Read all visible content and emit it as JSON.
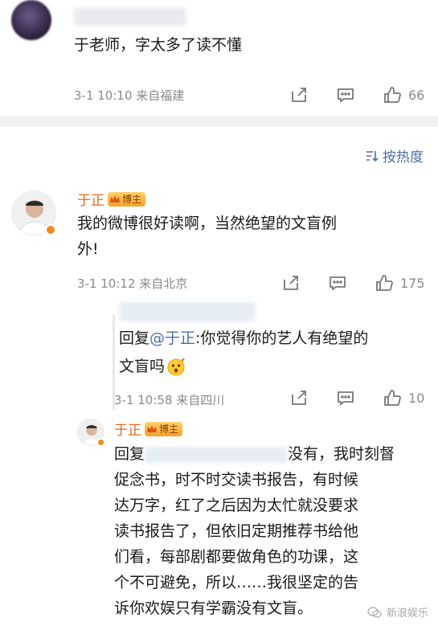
{
  "comment1": {
    "text": "于老师，字太多了读不懂",
    "meta": "3-1 10:10 来自福建",
    "likes": "66"
  },
  "sort": {
    "label": "按热度"
  },
  "comment2": {
    "author": "于正",
    "badge": "博主",
    "text_line1": "我的微博很好读啊，当然绝望的文盲例",
    "text_line2": "外!",
    "meta": "3-1 10:12 来自北京",
    "likes": "175"
  },
  "reply1": {
    "prefix": "回复",
    "mention": "@于正",
    "text_after": ":你觉得你的艺人有绝望的",
    "text_line2": "文盲吗",
    "meta": "3-1 10:58 来自四川",
    "likes": "10"
  },
  "reply2": {
    "author": "于正",
    "badge": "博主",
    "prefix": "回复",
    "lines": [
      "没有，我时刻督",
      "促念书，时不时交读书报告，有时候",
      "达万字，红了之后因为太忙就没要求",
      "读书报告了，但依旧定期推荐书给他",
      "们看，每部剧都要做角色的功课，这",
      "个不可避免，所以……我很坚定的告",
      "诉你欢娱只有学霸没有文盲。"
    ]
  },
  "watermark": {
    "text": "新浪娱乐"
  }
}
